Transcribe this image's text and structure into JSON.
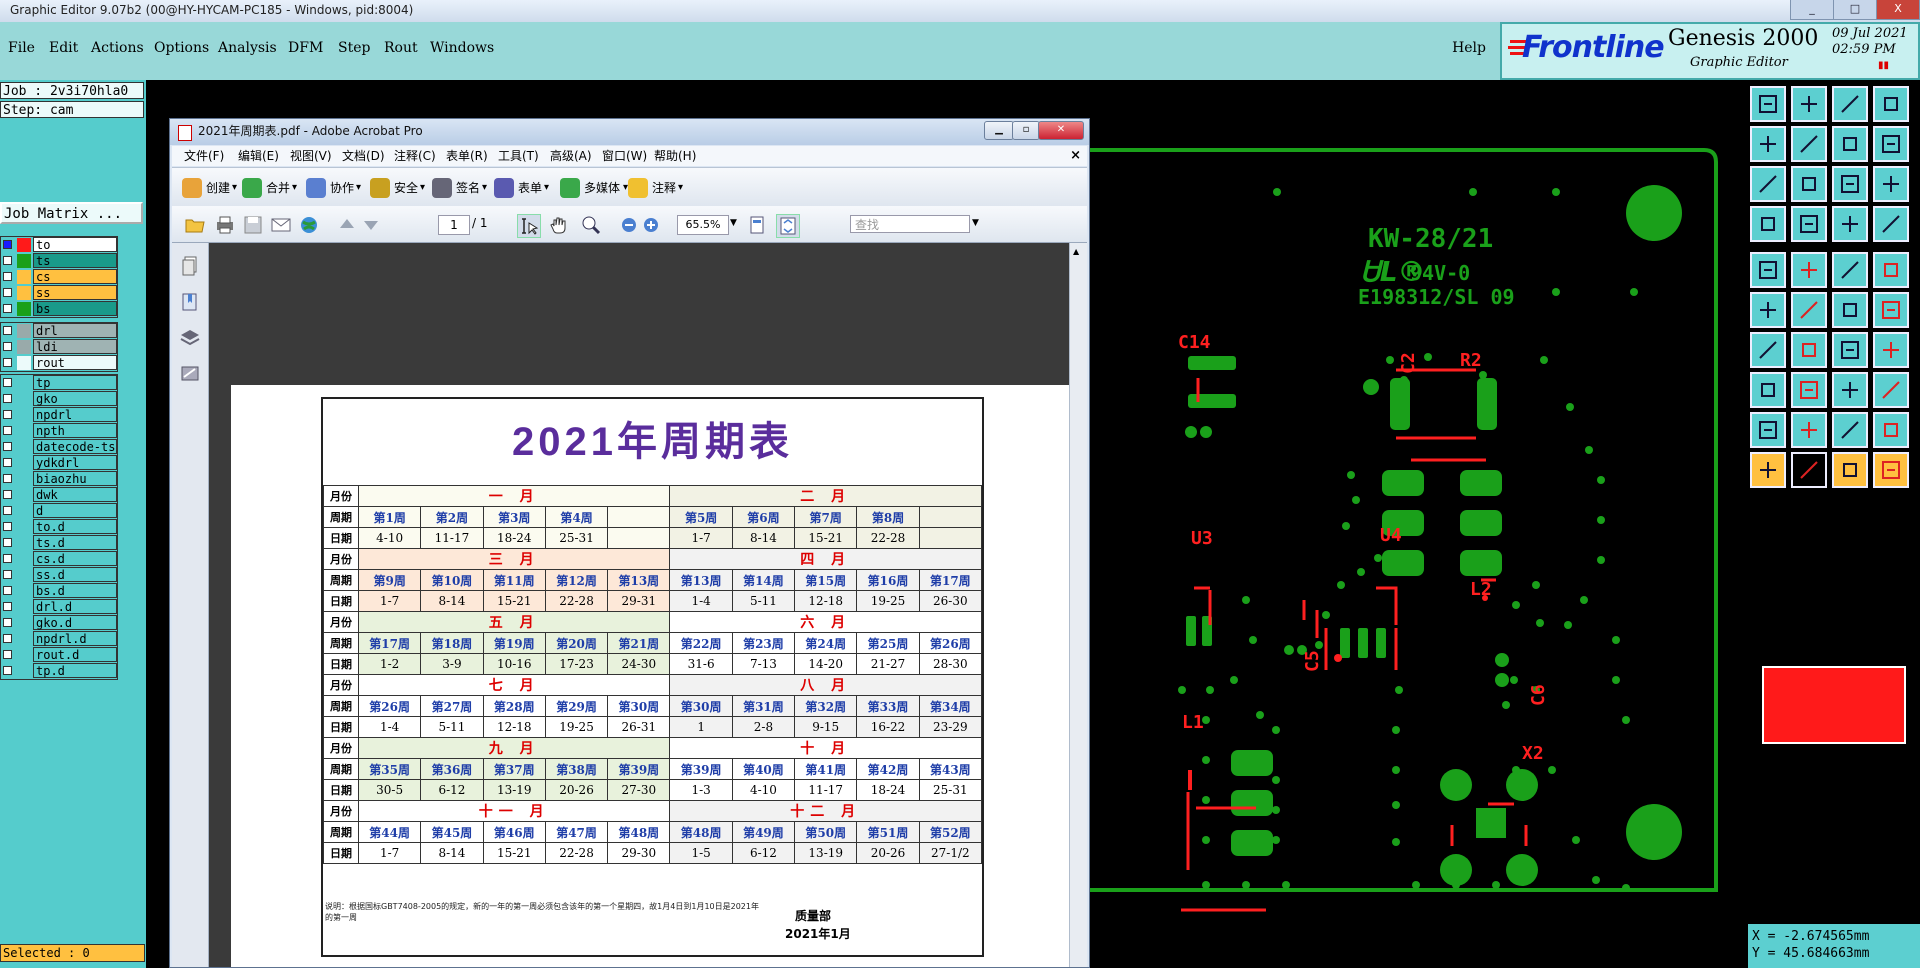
{
  "window": {
    "title": "Graphic Editor 9.07b2 (00@HY-HYCAM-PC185 - Windows, pid:8004)",
    "minimize": "_",
    "maximize": "□",
    "close": "X"
  },
  "menubar": {
    "items": [
      "File",
      "Edit",
      "Actions",
      "Options",
      "Analysis",
      "DFM",
      "Step",
      "Rout",
      "Windows"
    ],
    "help": "Help"
  },
  "branding": {
    "logo": "Frontline",
    "product": "Genesis 2000",
    "subtitle": "Graphic Editor",
    "date": "09 Jul 2021",
    "time": "02:59 PM"
  },
  "job": {
    "job_label": "Job : 2v3i70hla0",
    "step_label": "Step: cam",
    "matrix_button": "Job Matrix ..."
  },
  "layers": {
    "group1": [
      {
        "name": "to",
        "color": "#ff1a1a",
        "name_bg": "#ffffff",
        "active": true
      },
      {
        "name": "ts",
        "color": "#1aa01a",
        "name_bg": "#1a9a8a"
      },
      {
        "name": "cs",
        "color": "#ffc040",
        "name_bg": "#ffc040"
      },
      {
        "name": "ss",
        "color": "#ffc040",
        "name_bg": "#ffc040"
      },
      {
        "name": "bs",
        "color": "#1aa01a",
        "name_bg": "#1a9a8a"
      }
    ],
    "group2": [
      {
        "name": "drl",
        "color": "#9aa",
        "name_bg": "#9fb3b3"
      },
      {
        "name": "ldi",
        "color": "#9aa",
        "name_bg": "#9fb3b3"
      },
      {
        "name": "rout",
        "color": "#ecfafa",
        "name_bg": "#ecfafa"
      }
    ],
    "group3": [
      "tp",
      "gko",
      "npdrl",
      "npth",
      "datecode-ts",
      "ydkdrl",
      "biaozhu",
      "dwk",
      "d",
      "to.d",
      "ts.d",
      "cs.d",
      "ss.d",
      "bs.d",
      "drl.d",
      "gko.d",
      "npdrl.d",
      "rout.d",
      "tp.d"
    ]
  },
  "status": {
    "selected": "Selected : 0",
    "x": "X = -2.674565mm",
    "y": "Y = 45.684663mm"
  },
  "pcb": {
    "labels": [
      "KW-28/21",
      "94V-0",
      "E198312/SL 09",
      "C14",
      "R2",
      "C2",
      "U3",
      "U4",
      "C5",
      "L2",
      "C6",
      "L1",
      "X2"
    ]
  },
  "acrobat": {
    "title": "2021年周期表.pdf - Adobe Acrobat Pro",
    "menus": [
      "文件(F)",
      "编辑(E)",
      "视图(V)",
      "文档(D)",
      "注释(C)",
      "表单(R)",
      "工具(T)",
      "高级(A)",
      "窗口(W)",
      "帮助(H)"
    ],
    "toolbar1": [
      "创建",
      "合并",
      "协作",
      "安全",
      "签名",
      "表单",
      "多媒体",
      "注释"
    ],
    "page_current": "1",
    "page_total": "/ 1",
    "zoom": "65.5%",
    "search_placeholder": "查找"
  },
  "calendar": {
    "title_year": "2021",
    "title_text": "年周期表",
    "label_month": "月份",
    "label_week": "周期",
    "label_date": "日期",
    "rows": [
      {
        "left": {
          "month": "一 月",
          "bg": "#fbfbf0",
          "weeks": [
            "第1周",
            "第2周",
            "第3周",
            "第4周",
            ""
          ],
          "dates": [
            "4-10",
            "11-17",
            "18-24",
            "25-31",
            ""
          ]
        },
        "right": {
          "month": "二 月",
          "bg": "#f2f2e4",
          "weeks": [
            "第5周",
            "第6周",
            "第7周",
            "第8周",
            ""
          ],
          "dates": [
            "1-7",
            "8-14",
            "15-21",
            "22-28",
            ""
          ]
        }
      },
      {
        "left": {
          "month": "三 月",
          "bg": "#fde8d8",
          "weeks": [
            "第9周",
            "第10周",
            "第11周",
            "第12周",
            "第13周"
          ],
          "dates": [
            "1-7",
            "8-14",
            "15-21",
            "22-28",
            "29-31"
          ]
        },
        "right": {
          "month": "四 月",
          "bg": "#f2f2f2",
          "weeks": [
            "第13周",
            "第14周",
            "第15周",
            "第16周",
            "第17周"
          ],
          "dates": [
            "1-4",
            "5-11",
            "12-18",
            "19-25",
            "26-30"
          ]
        }
      },
      {
        "left": {
          "month": "五 月",
          "bg": "#e8f2dc",
          "weeks": [
            "第17周",
            "第18周",
            "第19周",
            "第20周",
            "第21周"
          ],
          "dates": [
            "1-2",
            "3-9",
            "10-16",
            "17-23",
            "24-30"
          ]
        },
        "right": {
          "month": "六 月",
          "bg": "#ffffff",
          "weeks": [
            "第22周",
            "第23周",
            "第24周",
            "第25周",
            "第26周"
          ],
          "dates": [
            "31-6",
            "7-13",
            "14-20",
            "21-27",
            "28-30"
          ]
        }
      },
      {
        "left": {
          "month": "七 月",
          "bg": "#ffffff",
          "weeks": [
            "第26周",
            "第27周",
            "第28周",
            "第29周",
            "第30周"
          ],
          "dates": [
            "1-4",
            "5-11",
            "12-18",
            "19-25",
            "26-31"
          ]
        },
        "right": {
          "month": "八 月",
          "bg": "#f2f2f2",
          "weeks": [
            "第30周",
            "第31周",
            "第32周",
            "第33周",
            "第34周"
          ],
          "dates": [
            "1",
            "2-8",
            "9-15",
            "16-22",
            "23-29"
          ]
        }
      },
      {
        "left": {
          "month": "九 月",
          "bg": "#e8f2dc",
          "weeks": [
            "第35周",
            "第36周",
            "第37周",
            "第38周",
            "第39周"
          ],
          "dates": [
            "30-5",
            "6-12",
            "13-19",
            "20-26",
            "27-30"
          ]
        },
        "right": {
          "month": "十 月",
          "bg": "#ffffff",
          "weeks": [
            "第39周",
            "第40周",
            "第41周",
            "第42周",
            "第43周"
          ],
          "dates": [
            "1-3",
            "4-10",
            "11-17",
            "18-24",
            "25-31"
          ]
        }
      },
      {
        "left": {
          "month": "十一 月",
          "bg": "#ffffff",
          "weeks": [
            "第44周",
            "第45周",
            "第46周",
            "第47周",
            "第48周"
          ],
          "dates": [
            "1-7",
            "8-14",
            "15-21",
            "22-28",
            "29-30"
          ]
        },
        "right": {
          "month": "十二 月",
          "bg": "#f2f2f2",
          "weeks": [
            "第48周",
            "第49周",
            "第50周",
            "第51周",
            "第52周"
          ],
          "dates": [
            "1-5",
            "6-12",
            "13-19",
            "20-26",
            "27-1/2"
          ]
        }
      }
    ],
    "note": "说明：根据国标GBT7408-2005的规定，新的一年的第一周必须包含该年的第一个星期四，故1月4日到1月10日是2021年的第一周",
    "dept": "质量部",
    "issued": "2021年1月"
  }
}
